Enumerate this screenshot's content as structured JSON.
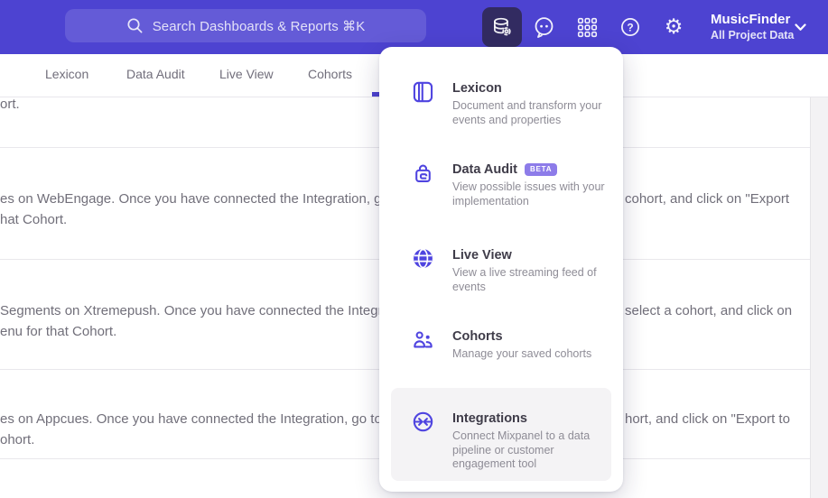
{
  "topbar": {
    "search_placeholder": "Search Dashboards & Reports ⌘K",
    "project_name": "MusicFinder",
    "project_scope": "All Project Data"
  },
  "icons": {
    "gear_glyph": "⚙"
  },
  "colors": {
    "topbar_bg": "#4d43d1",
    "active_icon_bg": "#322b61",
    "accent_indigo": "#4f44e0",
    "badge_purple": "#8d7ce9",
    "tab_underline": "#4c42cf"
  },
  "tabs": [
    {
      "label": "Lexicon"
    },
    {
      "label": "Data Audit"
    },
    {
      "label": "Live View"
    },
    {
      "label": "Cohorts"
    }
  ],
  "menu": {
    "items": [
      {
        "name": "lexicon",
        "title": "Lexicon",
        "description": "Document and transform your events and properties"
      },
      {
        "name": "data-audit",
        "title": "Data Audit",
        "badge": "BETA",
        "description": "View possible issues with your implementation"
      },
      {
        "name": "live-view",
        "title": "Live View",
        "description": "View a live streaming feed of events"
      },
      {
        "name": "cohorts",
        "title": "Cohorts",
        "description": "Manage your saved cohorts"
      },
      {
        "name": "integrations",
        "title": "Integrations",
        "description": "Connect Mixpanel to a data pipeline or customer engagement tool"
      }
    ]
  },
  "content": {
    "partial_top": "ort.",
    "rows": [
      {
        "left1": "es on WebEngage. Once you have connected the Integration, go to the",
        "left2": "hat Cohort.",
        "right1": "cohort, and click on \"Export"
      },
      {
        "left1": "Segments on Xtremepush. Once you have connected the Integration, ",
        "left2": "enu for that Cohort.",
        "right1": "select a cohort, and click on"
      },
      {
        "left1": "es on Appcues. Once you have connected the Integration, go to the M",
        "left2": "ohort.",
        "right1": "hort, and click on \"Export to"
      }
    ]
  }
}
